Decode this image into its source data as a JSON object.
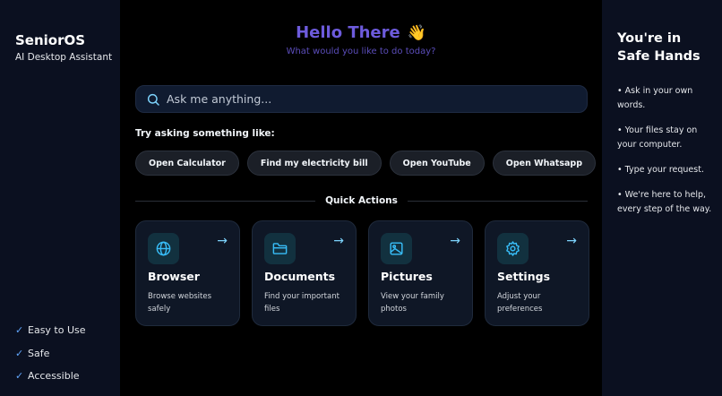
{
  "sidebar": {
    "app_name": "SeniorOS",
    "subtitle": "AI Desktop Assistant",
    "features": [
      {
        "check": "✓",
        "label": "Easy to Use"
      },
      {
        "check": "✓",
        "label": "Safe"
      },
      {
        "check": "✓",
        "label": "Accessible"
      }
    ]
  },
  "greeting": {
    "title": "Hello There",
    "emoji": "👋",
    "subtitle": "What would you like to do today?"
  },
  "search": {
    "placeholder": "Ask me anything..."
  },
  "suggestions": {
    "label": "Try asking something like:",
    "items": [
      "Open Calculator",
      "Find my electricity bill",
      "Open YouTube",
      "Open Whatsapp"
    ]
  },
  "quick_actions": {
    "title": "Quick Actions",
    "arrow": "→",
    "cards": [
      {
        "icon": "globe-icon",
        "title": "Browser",
        "desc": "Browse websites safely"
      },
      {
        "icon": "folder-icon",
        "title": "Documents",
        "desc": "Find your important files"
      },
      {
        "icon": "image-icon",
        "title": "Pictures",
        "desc": "View your family photos"
      },
      {
        "icon": "gear-icon",
        "title": "Settings",
        "desc": "Adjust your preferences"
      }
    ]
  },
  "right_panel": {
    "title": "You're in Safe Hands",
    "tips": [
      "• Ask in your own words.",
      "• Your files stay on your computer.",
      "• Type your request.",
      "• We're here to help, every step of the way."
    ]
  },
  "colors": {
    "accent_purple": "#6d5bdc",
    "icon_cyan": "#38bdf8",
    "check_blue": "#60a5fa",
    "panel_bg": "#0b1020"
  }
}
